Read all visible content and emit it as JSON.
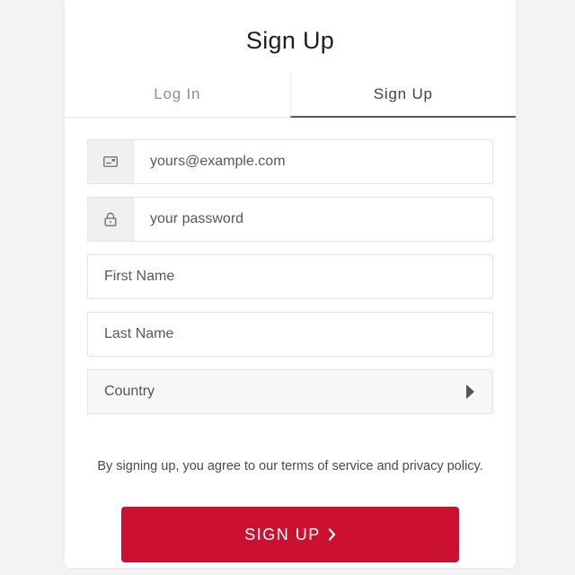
{
  "header": {
    "title": "Sign Up"
  },
  "tabs": [
    {
      "label": "Log In",
      "active": false
    },
    {
      "label": "Sign Up",
      "active": true
    }
  ],
  "form": {
    "email": {
      "placeholder": "yours@example.com",
      "icon": "envelope-icon"
    },
    "password": {
      "placeholder": "your password",
      "icon": "lock-icon"
    },
    "first_name": {
      "placeholder": "First Name"
    },
    "last_name": {
      "placeholder": "Last Name"
    },
    "country": {
      "placeholder": "Country",
      "icon": "caret-right-icon"
    }
  },
  "terms_text": "By signing up, you agree to our terms of service and privacy policy.",
  "submit": {
    "label": "SIGN UP",
    "icon": "chevron-right-icon",
    "color": "#cc1130"
  }
}
